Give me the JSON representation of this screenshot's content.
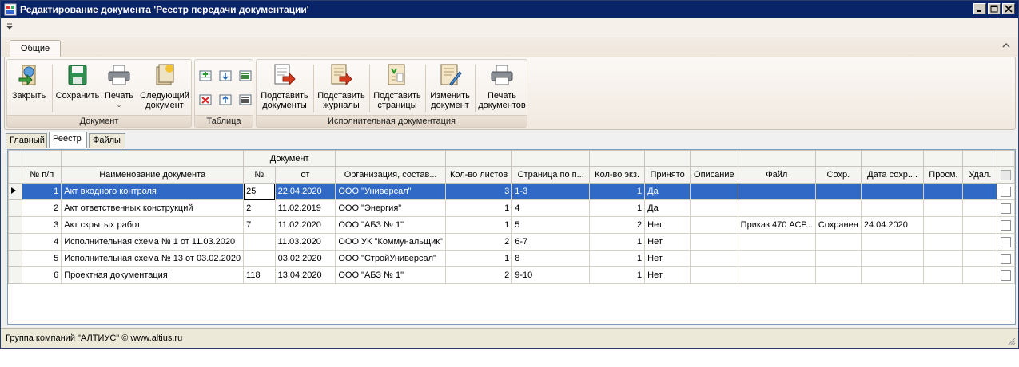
{
  "window": {
    "title": "Редактирование документа 'Реестр передачи документации'"
  },
  "ribbon": {
    "tab": "Общие",
    "groups": {
      "document": {
        "label": "Документ",
        "close": "Закрыть",
        "save": "Сохранить",
        "print": "Печать",
        "next": "Следующий",
        "next2": "документ"
      },
      "table": {
        "label": "Таблица"
      },
      "exec": {
        "label": "Исполнительная документация",
        "sub_docs": "Подставить",
        "sub_docs2": "документы",
        "sub_journals": "Подставить",
        "sub_journals2": "журналы",
        "sub_pages": "Подставить",
        "sub_pages2": "страницы",
        "change": "Изменить",
        "change2": "документ",
        "print_docs": "Печать",
        "print_docs2": "документов"
      }
    }
  },
  "doc_tabs": [
    "Главный",
    "Реестр",
    "Файлы"
  ],
  "grid": {
    "header_group": "Документ",
    "columns": {
      "num": "№ п/п",
      "name": "Наименование документа",
      "docnum": "№",
      "date": "от",
      "org": "Организация, состав...",
      "sheets": "Кол-во листов",
      "page": "Страница по п...",
      "copies": "Кол-во экз.",
      "accepted": "Принято",
      "desc": "Описание",
      "file": "Файл",
      "saved": "Сохр.",
      "saved_date": "Дата сохр....",
      "viewed": "Просм.",
      "deleted": "Удал."
    },
    "rows": [
      {
        "num": "1",
        "name": "Акт входного контроля",
        "docnum": "25",
        "date": "22.04.2020",
        "org": "ООО \"Универсал\"",
        "sheets": "3",
        "page": "1-3",
        "copies": "1",
        "accepted": "Да",
        "desc": "",
        "file": "",
        "saved": "",
        "saved_date": "",
        "viewed": "",
        "deleted": ""
      },
      {
        "num": "2",
        "name": "Акт ответственных конструкций",
        "docnum": "2",
        "date": "11.02.2019",
        "org": "ООО \"Энергия\"",
        "sheets": "1",
        "page": "4",
        "copies": "1",
        "accepted": "Да",
        "desc": "",
        "file": "",
        "saved": "",
        "saved_date": "",
        "viewed": "",
        "deleted": ""
      },
      {
        "num": "3",
        "name": "Акт скрытых работ",
        "docnum": "7",
        "date": "11.02.2020",
        "org": "ООО \"АБЗ № 1\"",
        "sheets": "1",
        "page": "5",
        "copies": "2",
        "accepted": "Нет",
        "desc": "",
        "file": "Приказ 470 АСР...",
        "saved": "Сохранен",
        "saved_date": "24.04.2020",
        "viewed": "",
        "deleted": ""
      },
      {
        "num": "4",
        "name": "Исполнительная схема № 1 от 11.03.2020",
        "docnum": "",
        "date": "11.03.2020",
        "org": "ООО УК \"Коммунальщик\"",
        "sheets": "2",
        "page": "6-7",
        "copies": "1",
        "accepted": "Нет",
        "desc": "",
        "file": "",
        "saved": "",
        "saved_date": "",
        "viewed": "",
        "deleted": ""
      },
      {
        "num": "5",
        "name": "Исполнительная схема № 13 от 03.02.2020",
        "docnum": "",
        "date": "03.02.2020",
        "org": "ООО \"СтройУниверсал\"",
        "sheets": "1",
        "page": "8",
        "copies": "1",
        "accepted": "Нет",
        "desc": "",
        "file": "",
        "saved": "",
        "saved_date": "",
        "viewed": "",
        "deleted": ""
      },
      {
        "num": "6",
        "name": "Проектная документация",
        "docnum": "118",
        "date": "13.04.2020",
        "org": "ООО \"АБЗ № 1\"",
        "sheets": "2",
        "page": "9-10",
        "copies": "1",
        "accepted": "Нет",
        "desc": "",
        "file": "",
        "saved": "",
        "saved_date": "",
        "viewed": "",
        "deleted": ""
      }
    ]
  },
  "status": {
    "text": "Группа компаний \"АЛТИУС\" © www.altius.ru"
  },
  "colors": {
    "titlebar": "#0a246a",
    "selection": "#3169c6"
  }
}
